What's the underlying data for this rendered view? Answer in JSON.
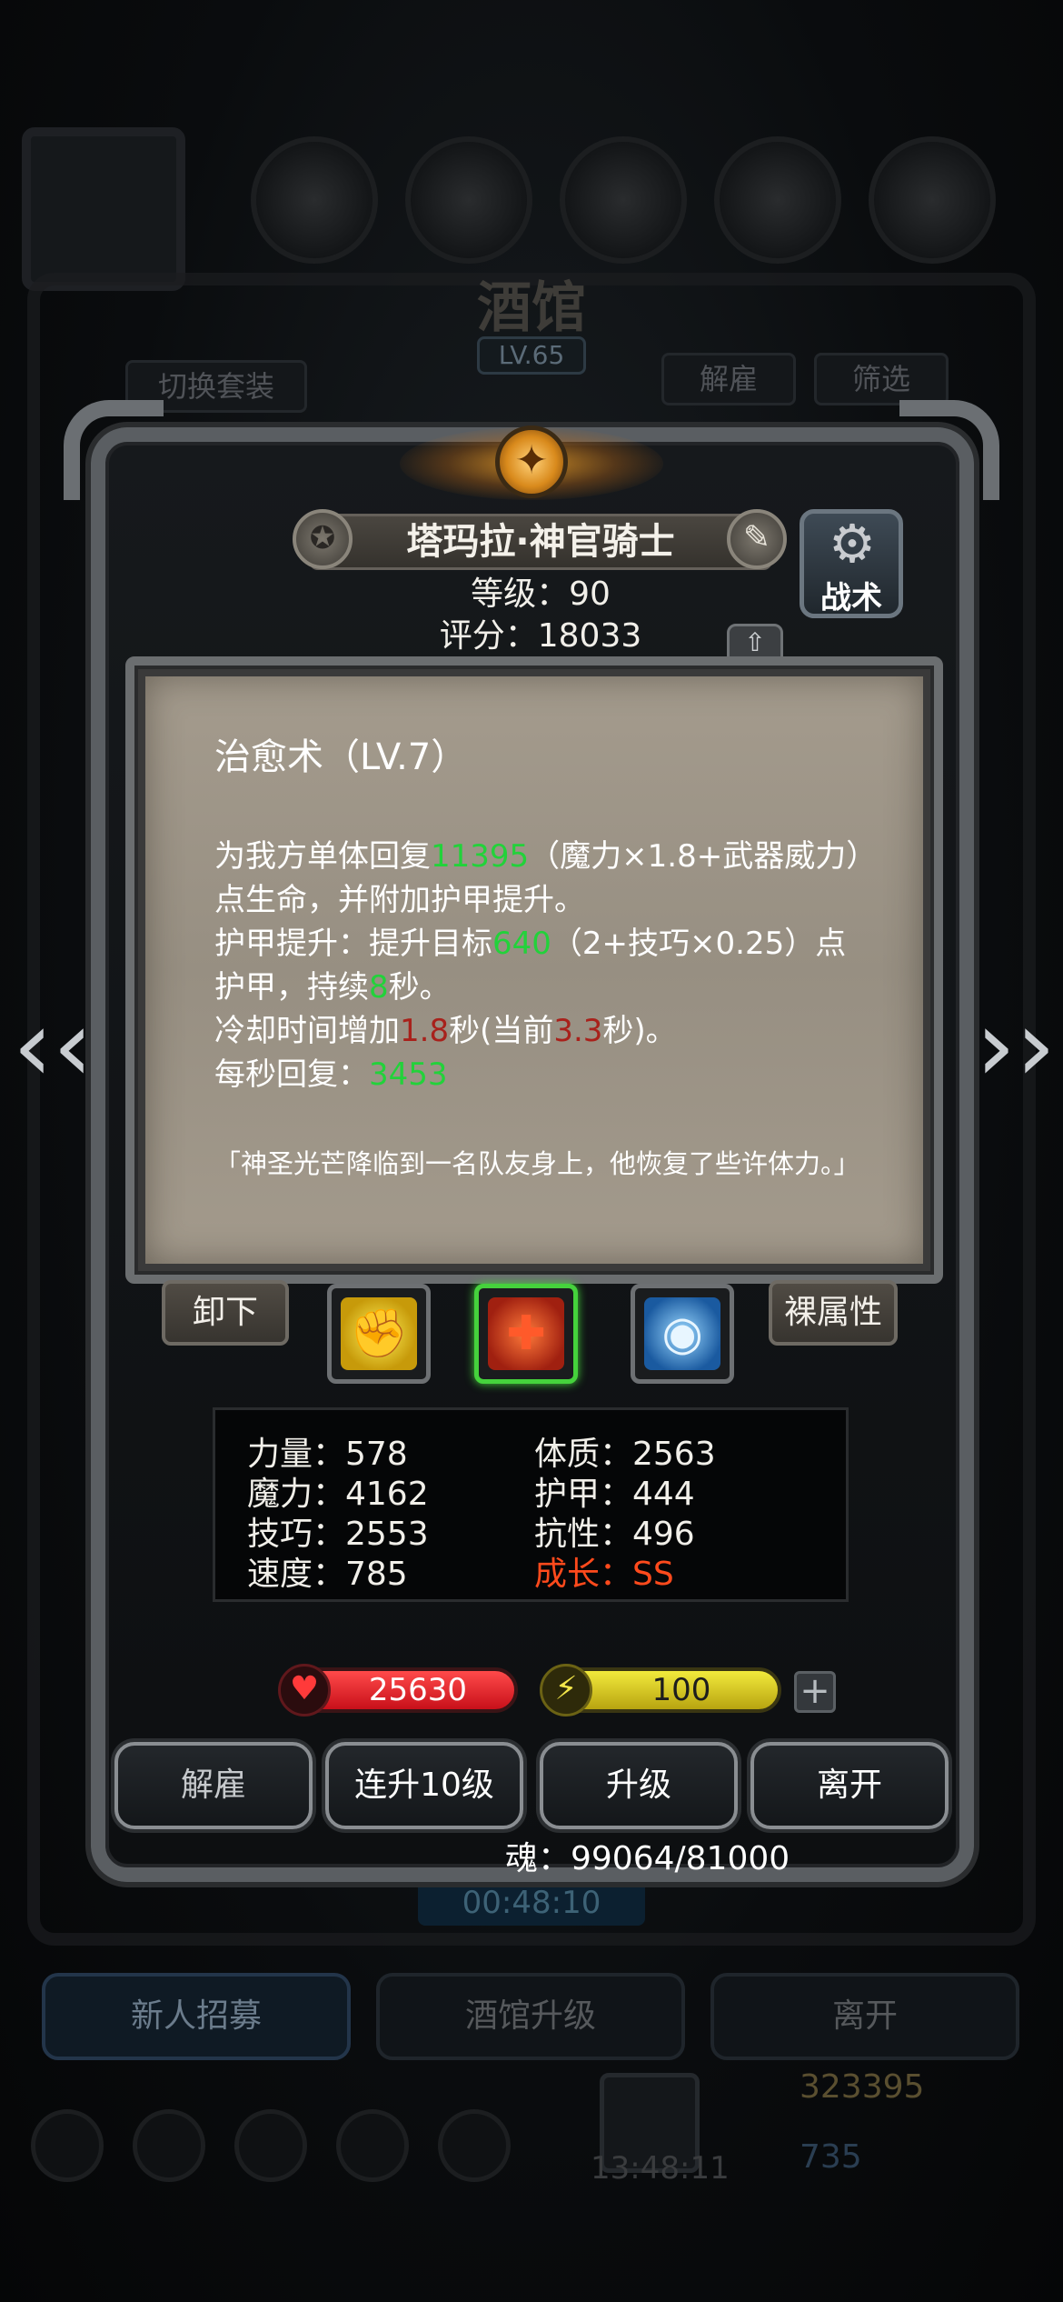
{
  "background": {
    "screen_title": "酒馆",
    "screen_level": "LV.65",
    "switch_outfit_label": "切换套装",
    "dismiss_label": "解雇",
    "filter_label": "筛选",
    "timer": "00:48:10",
    "bottom_buttons": [
      "新人招募",
      "酒馆升级",
      "离开"
    ],
    "gold": "323395",
    "gems": "735",
    "clock": "13:48:11"
  },
  "hero": {
    "name": "塔玛拉·神官骑士",
    "level_text": "等级：90",
    "score_text": "评分：18033",
    "tactics_label": "战术"
  },
  "skill": {
    "title": "治愈术（LV.7）",
    "desc": {
      "p1_a": "为我方单体回复",
      "p1_v": "11395",
      "p1_b": "（魔力×1.8+武器威力）点生命，并附加护甲提升。",
      "p2_a": "护甲提升：提升目标",
      "p2_v": "640",
      "p2_b": "（2+技巧×0.25）点护甲，持续",
      "p2_v2": "8",
      "p2_c": "秒。",
      "p3_a": "冷却时间增加",
      "p3_v": "1.8",
      "p3_b": "秒(当前",
      "p3_v2": "3.3",
      "p3_c": "秒)。",
      "p4_a": "每秒回复：",
      "p4_v": "3453"
    },
    "quote": "「神圣光芒降临到一名队友身上，他恢复了些许体力。」"
  },
  "equip_row": {
    "unequip_label": "卸下",
    "naked_attr_label": "裸属性",
    "slots": [
      "fist-icon",
      "red-cross-icon",
      "eye-icon"
    ]
  },
  "stats": {
    "strength": "力量：578",
    "magic": "魔力：4162",
    "skill": "技巧：2553",
    "speed": "速度：785",
    "constitution": "体质：2563",
    "armor": "护甲：444",
    "resistance": "抗性：496",
    "growth": "成长：SS"
  },
  "bars": {
    "hp": "25630",
    "energy": "100",
    "plus": "+"
  },
  "actions": {
    "dismiss": "解雇",
    "level_up_10": "连升10级",
    "level_up": "升级",
    "leave": "离开"
  },
  "soul": "魂：99064/81000",
  "colors": {
    "highlight_green": "#22d23a",
    "highlight_red": "#a8211b",
    "growth_orange": "#ff4a1c"
  }
}
